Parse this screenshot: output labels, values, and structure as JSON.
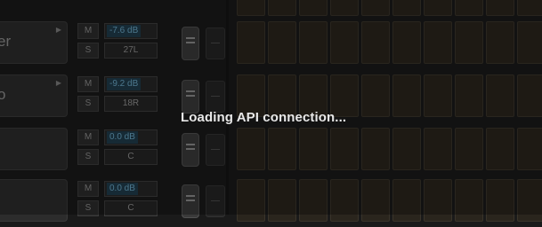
{
  "tracks": [
    {
      "name": "er",
      "mute": "M",
      "solo": "S",
      "volume": "-7.6 dB",
      "pan": "27L",
      "has_fold": true
    },
    {
      "name": "o",
      "mute": "M",
      "solo": "S",
      "volume": "-9.2 dB",
      "pan": "18R",
      "has_fold": true
    },
    {
      "name": "",
      "mute": "M",
      "solo": "S",
      "volume": "0.0 dB",
      "pan": "C",
      "has_fold": false
    },
    {
      "name": "",
      "mute": "M",
      "solo": "S",
      "volume": "0.0 dB",
      "pan": "C",
      "has_fold": false
    }
  ],
  "overlay": {
    "message": "Loading API connection..."
  },
  "colors": {
    "background": "#1a1a1a",
    "volume_accent": "#6aa6c4",
    "clip_cell": "#2a251d"
  }
}
